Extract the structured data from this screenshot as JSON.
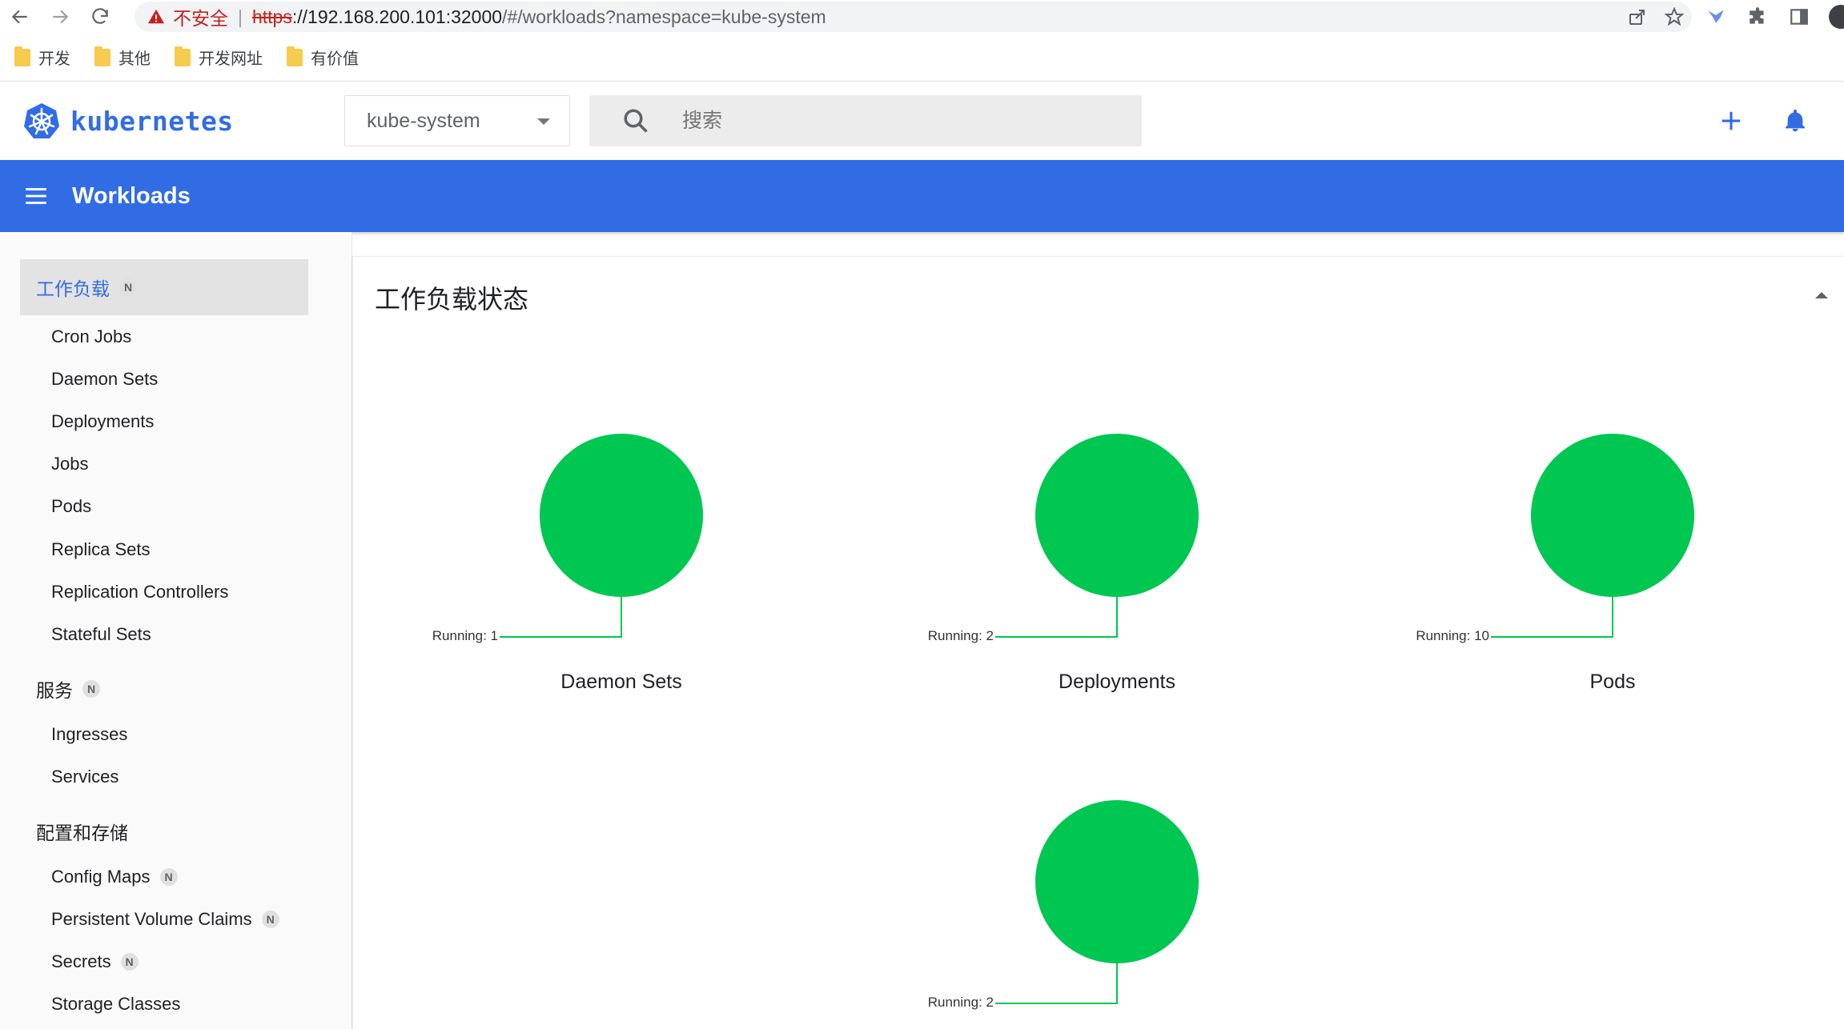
{
  "browser": {
    "insecure_text": "不安全",
    "url_scheme": "https",
    "url_host": "://192.168.200.101:32000",
    "url_path": "/#/workloads?namespace=kube-system"
  },
  "bookmarks": [
    {
      "label": "开发"
    },
    {
      "label": "其他"
    },
    {
      "label": "开发网址"
    },
    {
      "label": "有价值"
    }
  ],
  "header": {
    "logo_text": "kubernetes",
    "namespace": "kube-system",
    "search_placeholder": "搜索"
  },
  "toolbar": {
    "title": "Workloads"
  },
  "sidebar": {
    "sections": [
      {
        "label": "工作负载",
        "badge": "N",
        "active": true
      },
      {
        "label": "服务",
        "badge": "N"
      },
      {
        "label": "配置和存储",
        "badge": ""
      }
    ],
    "workloads_items": [
      {
        "label": "Cron Jobs"
      },
      {
        "label": "Daemon Sets"
      },
      {
        "label": "Deployments"
      },
      {
        "label": "Jobs"
      },
      {
        "label": "Pods"
      },
      {
        "label": "Replica Sets"
      },
      {
        "label": "Replication Controllers"
      },
      {
        "label": "Stateful Sets"
      }
    ],
    "service_items": [
      {
        "label": "Ingresses"
      },
      {
        "label": "Services"
      }
    ],
    "config_items": [
      {
        "label": "Config Maps",
        "badge": "N"
      },
      {
        "label": "Persistent Volume Claims",
        "badge": "N"
      },
      {
        "label": "Secrets",
        "badge": "N"
      },
      {
        "label": "Storage Classes",
        "badge": ""
      }
    ]
  },
  "card": {
    "title": "工作负载状态"
  },
  "colors": {
    "primary": "#326ce5",
    "running": "#00c752"
  },
  "chart_data": [
    {
      "type": "pie",
      "title": "Daemon Sets",
      "slices": [
        {
          "label": "Running",
          "value": 1
        }
      ],
      "label_text": "Running: 1"
    },
    {
      "type": "pie",
      "title": "Deployments",
      "slices": [
        {
          "label": "Running",
          "value": 2
        }
      ],
      "label_text": "Running: 2"
    },
    {
      "type": "pie",
      "title": "Pods",
      "slices": [
        {
          "label": "Running",
          "value": 10
        }
      ],
      "label_text": "Running: 10"
    },
    {
      "type": "pie",
      "title": "",
      "slices": [
        {
          "label": "Running",
          "value": 2
        }
      ],
      "label_text": "Running: 2"
    }
  ]
}
